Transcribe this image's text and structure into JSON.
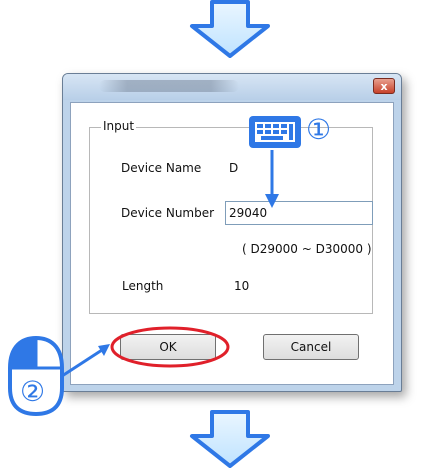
{
  "dialog": {
    "group_label": "Input",
    "device_name_label": "Device Name",
    "device_name_value": "D",
    "device_number_label": "Device Number",
    "device_number_value": "29040",
    "range_text": "( D29000 ~ D30000 )",
    "length_label": "Length",
    "length_value": "10",
    "ok_label": "OK",
    "cancel_label": "Cancel",
    "close_glyph": "x"
  },
  "annotations": {
    "step1": "①",
    "step2": "②",
    "highlight_color": "#e0202a",
    "arrow_color": "#2f78e6"
  }
}
